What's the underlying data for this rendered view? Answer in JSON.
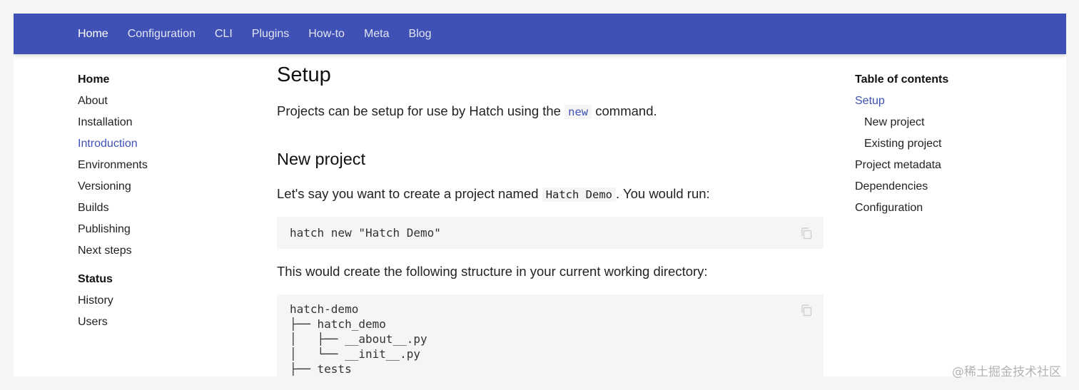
{
  "topnav": {
    "items": [
      "Home",
      "Configuration",
      "CLI",
      "Plugins",
      "How-to",
      "Meta",
      "Blog"
    ]
  },
  "leftnav": {
    "section_home": "Home",
    "home_items": [
      "About",
      "Installation",
      "Introduction",
      "Environments",
      "Versioning",
      "Builds",
      "Publishing",
      "Next steps"
    ],
    "section_status": "Status",
    "status_items": [
      "History",
      "Users"
    ]
  },
  "content": {
    "title": "Setup",
    "intro_before": "Projects can be setup for use by Hatch using the ",
    "intro_code": "new",
    "intro_after": " command.",
    "h2_new_project": "New project",
    "p2_before": "Let's say you want to create a project named ",
    "p2_code": "Hatch Demo",
    "p2_after": ". You would run:",
    "code1": "hatch new \"Hatch Demo\"",
    "p3": "This would create the following structure in your current working directory:",
    "code2": "hatch-demo\n├── hatch_demo\n│   ├── __about__.py\n│   └── __init__.py\n├── tests"
  },
  "toc": {
    "title": "Table of contents",
    "items": [
      "Setup",
      "New project",
      "Existing project",
      "Project metadata",
      "Dependencies",
      "Configuration"
    ]
  },
  "watermark": "@稀土掘金技术社区",
  "colors": {
    "primary": "#3f51b5",
    "code_bg": "#f5f5f5",
    "page_bg": "#f5f5f5"
  },
  "icons": {
    "copy": "copy-icon"
  }
}
